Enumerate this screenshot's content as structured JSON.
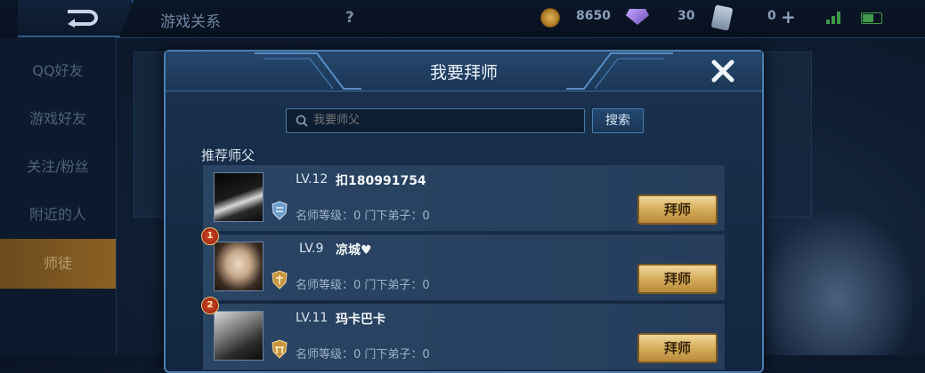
{
  "topbar": {
    "title": "游戏关系",
    "help": "?",
    "gold": "8650",
    "diamonds": "30",
    "vouchers": "0",
    "plus": "+"
  },
  "sidebar": {
    "items": [
      {
        "label": "QQ好友",
        "active": false
      },
      {
        "label": "游戏好友",
        "active": false
      },
      {
        "label": "关注/粉丝",
        "active": false
      },
      {
        "label": "附近的人",
        "active": false
      },
      {
        "label": "师徒",
        "active": true
      }
    ]
  },
  "modal": {
    "title": "我要拜师",
    "search": {
      "placeholder": "我要师父",
      "button_label": "搜索"
    },
    "section_label": "推荐师父",
    "masters": [
      {
        "level": "LV.12",
        "name": "扣180991754",
        "info": "名师等级：0 门下弟子：0",
        "button": "拜师",
        "rank": ""
      },
      {
        "level": "LV.9",
        "name": "凉城♥",
        "info": "名师等级：0 门下弟子：0",
        "button": "拜师",
        "rank": "1"
      },
      {
        "level": "LV.11",
        "name": "玛卡巴卡",
        "info": "名师等级：0 门下弟子：0",
        "button": "拜师",
        "rank": "2"
      }
    ]
  },
  "colors": {
    "accent_gold": "#d2a957",
    "panel_blue": "#1b3452",
    "border_blue": "#4c7fb0"
  }
}
